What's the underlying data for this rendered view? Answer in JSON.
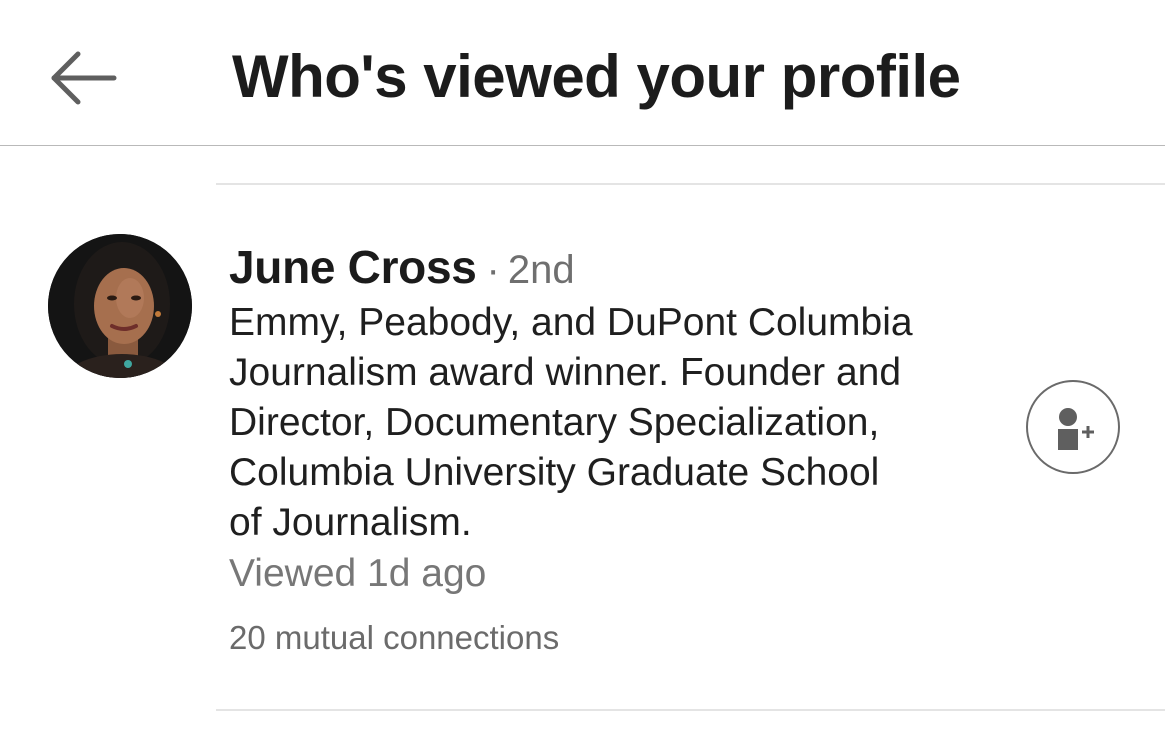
{
  "header": {
    "back_icon": "arrow-left-icon",
    "title": "Who's viewed your profile"
  },
  "viewer": {
    "name": "June Cross",
    "separator": "·",
    "degree": "2nd",
    "headline_lines": [
      "Emmy, Peabody, and DuPont Columbia",
      "Journalism award winner. Founder and",
      "Director, Documentary Specialization,",
      "Columbia University Graduate School",
      "of Journalism."
    ],
    "viewed": "Viewed 1d ago",
    "mutual_connections": "20 mutual connections",
    "connect_icon": "add-connection-icon",
    "avatar_icon": "profile-photo"
  },
  "colors": {
    "text_primary": "#1d1d1d",
    "text_secondary": "#6f6f6f",
    "divider": "#e4e4e4",
    "icon_gray": "#6a6a6a"
  }
}
